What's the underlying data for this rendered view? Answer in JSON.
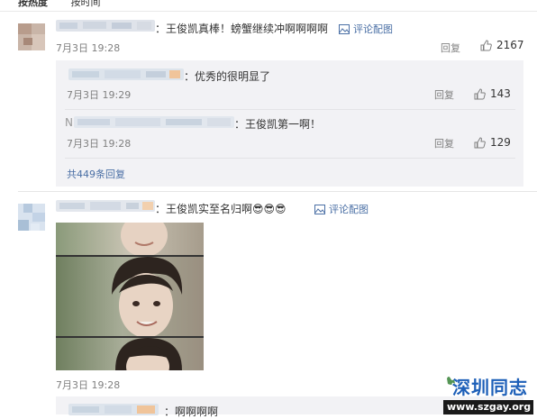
{
  "tabs": [
    "按热度",
    "按时间"
  ],
  "comments": [
    {
      "text": "：王俊凯真棒！螃蟹继续冲啊啊啊啊",
      "link": "评论配图",
      "time": "7月3日 19:28",
      "reply": "回复",
      "likes": "2167",
      "replies": [
        {
          "text": "：优秀的很明显了",
          "time": "7月3日 19:29",
          "reply": "回复",
          "likes": "143"
        },
        {
          "name_prefix": "N",
          "text": "：王俊凯第一啊！",
          "time": "7月3日 19:28",
          "reply": "回复",
          "likes": "129"
        }
      ],
      "more": "共449条回复"
    },
    {
      "text": "：王俊凯实至名归啊",
      "emoji": "😎😎😎",
      "link": "评论配图",
      "time": "7月3日 19:28"
    },
    {
      "text": "：啊啊啊啊"
    }
  ],
  "watermark": {
    "title": "深圳同志",
    "url": "www.szgay.org"
  },
  "colors": {
    "link": "#4a6fa5",
    "subbox": "#f2f2f5",
    "meta": "#808080"
  }
}
